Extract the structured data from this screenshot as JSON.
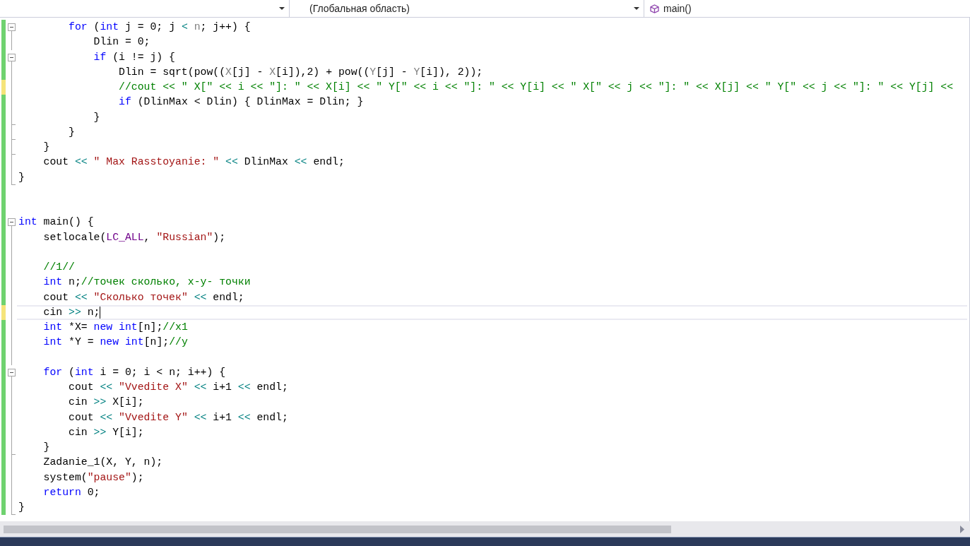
{
  "navigation_bar": {
    "scope": "(Глобальная область)",
    "member": "main()"
  },
  "editor": {
    "lines": [
      {
        "unsaved": false,
        "kind": "block_start",
        "tokens": [
          {
            "kind": "kw",
            "text": "        for"
          },
          {
            "kind": "plain",
            "text": " ("
          },
          {
            "kind": "kw",
            "text": "int"
          },
          {
            "kind": "plain",
            "text": " j = 0; j"
          },
          {
            "kind": "op",
            "text": " <"
          },
          {
            "kind": "param",
            "text": " n"
          },
          {
            "kind": "plain",
            "text": "; j++) {"
          }
        ]
      },
      {
        "unsaved": false,
        "kind": "block_body",
        "tokens": [
          {
            "kind": "plain",
            "text": "            Dlin = 0;"
          }
        ]
      },
      {
        "unsaved": false,
        "kind": "block_start",
        "tokens": [
          {
            "kind": "kw",
            "text": "            if"
          },
          {
            "kind": "plain",
            "text": " (i != j) {"
          }
        ]
      },
      {
        "unsaved": false,
        "kind": "block_body",
        "tokens": [
          {
            "kind": "plain",
            "text": "                Dlin = sqrt(pow(("
          },
          {
            "kind": "param",
            "text": "X"
          },
          {
            "kind": "plain",
            "text": "[j] - "
          },
          {
            "kind": "param",
            "text": "X"
          },
          {
            "kind": "plain",
            "text": "[i]),2) + pow(("
          },
          {
            "kind": "param",
            "text": "Y"
          },
          {
            "kind": "plain",
            "text": "[j] - "
          },
          {
            "kind": "param",
            "text": "Y"
          },
          {
            "kind": "plain",
            "text": "[i]), 2));"
          }
        ]
      },
      {
        "unsaved": true,
        "kind": "block_body",
        "tokens": [
          {
            "kind": "comment",
            "text": "                //cout << \" X[\" << i << \"]: \" << X[i] << \" Y[\" << i << \"]: \" << Y[i] << \" X[\" << j << \"]: \" << X[j] << \" Y[\" << j << \"]: \" << Y[j] <<"
          }
        ]
      },
      {
        "unsaved": false,
        "kind": "block_body",
        "tokens": [
          {
            "kind": "kw",
            "text": "                if"
          },
          {
            "kind": "plain",
            "text": " (DlinMax < Dlin) { DlinMax = Dlin; }"
          }
        ]
      },
      {
        "unsaved": false,
        "kind": "block_end",
        "tokens": [
          {
            "kind": "plain",
            "text": "            }"
          }
        ]
      },
      {
        "unsaved": false,
        "kind": "block_end",
        "tokens": [
          {
            "kind": "plain",
            "text": "        }"
          }
        ]
      },
      {
        "unsaved": false,
        "kind": "block_end",
        "tokens": [
          {
            "kind": "plain",
            "text": "    }"
          }
        ]
      },
      {
        "unsaved": false,
        "kind": "block_body",
        "tokens": [
          {
            "kind": "plain",
            "text": "    cout"
          },
          {
            "kind": "op",
            "text": " <<"
          },
          {
            "kind": "str",
            "text": " \" Max Rasstoyanie: \""
          },
          {
            "kind": "op",
            "text": " <<"
          },
          {
            "kind": "plain",
            "text": " DlinMax"
          },
          {
            "kind": "op",
            "text": " <<"
          },
          {
            "kind": "plain",
            "text": " endl;"
          }
        ]
      },
      {
        "unsaved": false,
        "kind": "block_end",
        "tokens": [
          {
            "kind": "plain",
            "text": "}"
          }
        ]
      },
      {
        "unsaved": false
      },
      {
        "unsaved": false
      },
      {
        "unsaved": false,
        "kind": "block_start",
        "tokens": [
          {
            "kind": "kw",
            "text": "int"
          },
          {
            "kind": "plain",
            "text": " main() {"
          }
        ]
      },
      {
        "unsaved": false,
        "kind": "block_body",
        "tokens": [
          {
            "kind": "plain",
            "text": "    setlocale("
          },
          {
            "kind": "macro",
            "text": "LC_ALL"
          },
          {
            "kind": "plain",
            "text": ", "
          },
          {
            "kind": "str",
            "text": "\"Russian\""
          },
          {
            "kind": "plain",
            "text": ");"
          }
        ]
      },
      {
        "unsaved": false,
        "kind": "block_body"
      },
      {
        "unsaved": false,
        "kind": "block_body",
        "tokens": [
          {
            "kind": "comment",
            "text": "    //1//"
          }
        ]
      },
      {
        "unsaved": false,
        "kind": "block_body",
        "tokens": [
          {
            "kind": "kw",
            "text": "    int"
          },
          {
            "kind": "plain",
            "text": " n;"
          },
          {
            "kind": "comment",
            "text": "//точек сколько, x-y- точки"
          }
        ]
      },
      {
        "unsaved": false,
        "kind": "block_body",
        "tokens": [
          {
            "kind": "plain",
            "text": "    cout"
          },
          {
            "kind": "op",
            "text": " <<"
          },
          {
            "kind": "str",
            "text": " \"Сколько точек\""
          },
          {
            "kind": "op",
            "text": " <<"
          },
          {
            "kind": "plain",
            "text": " endl;"
          }
        ]
      },
      {
        "unsaved": true,
        "kind": "block_body",
        "current": true,
        "tokens": [
          {
            "kind": "plain",
            "text": "    cin"
          },
          {
            "kind": "op",
            "text": " >>"
          },
          {
            "kind": "plain",
            "text": " n;"
          }
        ]
      },
      {
        "unsaved": false,
        "kind": "block_body",
        "tokens": [
          {
            "kind": "kw",
            "text": "    int"
          },
          {
            "kind": "plain",
            "text": " *X="
          },
          {
            "kind": "kw",
            "text": " new"
          },
          {
            "kind": "kw",
            "text": " int"
          },
          {
            "kind": "plain",
            "text": "[n];"
          },
          {
            "kind": "comment",
            "text": "//x1"
          }
        ]
      },
      {
        "unsaved": false,
        "kind": "block_body",
        "tokens": [
          {
            "kind": "kw",
            "text": "    int"
          },
          {
            "kind": "plain",
            "text": " *Y ="
          },
          {
            "kind": "kw",
            "text": " new"
          },
          {
            "kind": "kw",
            "text": " int"
          },
          {
            "kind": "plain",
            "text": "[n];"
          },
          {
            "kind": "comment",
            "text": "//y"
          }
        ]
      },
      {
        "unsaved": false,
        "kind": "block_body"
      },
      {
        "unsaved": false,
        "kind": "block_start",
        "tokens": [
          {
            "kind": "kw",
            "text": "    for"
          },
          {
            "kind": "plain",
            "text": " ("
          },
          {
            "kind": "kw",
            "text": "int"
          },
          {
            "kind": "plain",
            "text": " i = 0; i < n; i++) {"
          }
        ]
      },
      {
        "unsaved": false,
        "kind": "block_body",
        "tokens": [
          {
            "kind": "plain",
            "text": "        cout"
          },
          {
            "kind": "op",
            "text": " <<"
          },
          {
            "kind": "str",
            "text": " \"Vvedite X\""
          },
          {
            "kind": "op",
            "text": " <<"
          },
          {
            "kind": "plain",
            "text": " i+1"
          },
          {
            "kind": "op",
            "text": " <<"
          },
          {
            "kind": "plain",
            "text": " endl;"
          }
        ]
      },
      {
        "unsaved": false,
        "kind": "block_body",
        "tokens": [
          {
            "kind": "plain",
            "text": "        cin"
          },
          {
            "kind": "op",
            "text": " >>"
          },
          {
            "kind": "plain",
            "text": " X[i];"
          }
        ]
      },
      {
        "unsaved": false,
        "kind": "block_body",
        "tokens": [
          {
            "kind": "plain",
            "text": "        cout"
          },
          {
            "kind": "op",
            "text": " <<"
          },
          {
            "kind": "str",
            "text": " \"Vvedite Y\""
          },
          {
            "kind": "op",
            "text": " <<"
          },
          {
            "kind": "plain",
            "text": " i+1"
          },
          {
            "kind": "op",
            "text": " <<"
          },
          {
            "kind": "plain",
            "text": " endl;"
          }
        ]
      },
      {
        "unsaved": false,
        "kind": "block_body",
        "tokens": [
          {
            "kind": "plain",
            "text": "        cin"
          },
          {
            "kind": "op",
            "text": " >>"
          },
          {
            "kind": "plain",
            "text": " Y[i];"
          }
        ]
      },
      {
        "unsaved": false,
        "kind": "block_end",
        "tokens": [
          {
            "kind": "plain",
            "text": "    }"
          }
        ]
      },
      {
        "unsaved": false,
        "kind": "block_body",
        "tokens": [
          {
            "kind": "plain",
            "text": "    Zadanie_1(X, Y, n);"
          }
        ]
      },
      {
        "unsaved": false,
        "kind": "block_body",
        "tokens": [
          {
            "kind": "plain",
            "text": "    system("
          },
          {
            "kind": "str",
            "text": "\"pause\""
          },
          {
            "kind": "plain",
            "text": ");"
          }
        ]
      },
      {
        "unsaved": false,
        "kind": "block_body",
        "tokens": [
          {
            "kind": "kw",
            "text": "    return"
          },
          {
            "kind": "plain",
            "text": " 0;"
          }
        ]
      },
      {
        "unsaved": false,
        "kind": "block_end",
        "tokens": [
          {
            "kind": "plain",
            "text": "}"
          }
        ]
      }
    ]
  }
}
